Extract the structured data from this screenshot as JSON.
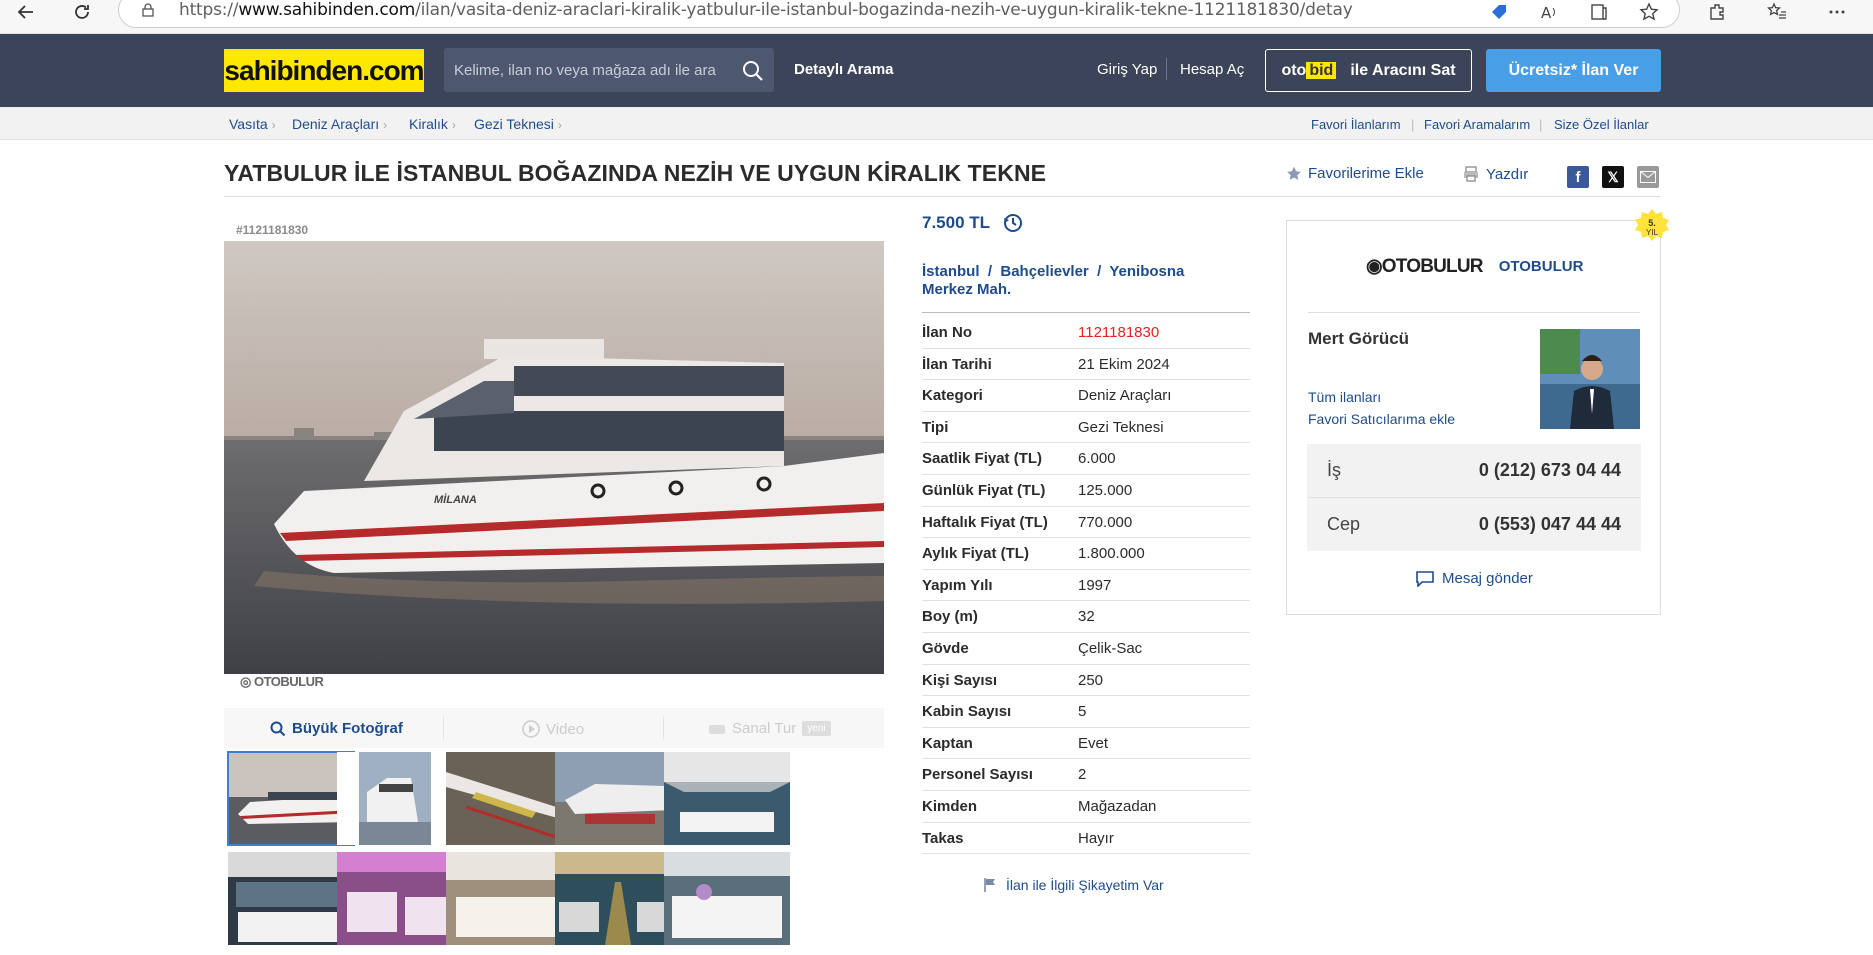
{
  "browser": {
    "url_prefix": "https://",
    "url_host": "www.sahibinden.com",
    "url_path": "/ilan/vasita-deniz-araclari-kiralik-yatbulur-ile-istanbul-bogazinda-nezih-ve-uygun-kiralik-tekne-1121181830/detay"
  },
  "header": {
    "logo": "sahibinden.com",
    "search_placeholder": "Kelime, ilan no veya mağaza adı ile ara",
    "advanced_search": "Detaylı Arama",
    "login": "Giriş Yap",
    "register": "Hesap Aç",
    "otobid_oto": "oto",
    "otobid_bid": "bid",
    "otobid_label": "ile Aracını Sat",
    "post_ad": "Ücretsiz* İlan Ver"
  },
  "breadcrumb": [
    "Vasıta",
    "Deniz Araçları",
    "Kiralık",
    "Gezi Teknesi"
  ],
  "top_links": [
    "Favori İlanlarım",
    "Favori Aramalarım",
    "Size Özel İlanlar"
  ],
  "listing": {
    "title": "YATBULUR İLE İSTANBUL BOĞAZINDA NEZİH VE UYGUN KİRALIK TEKNE",
    "add_favorite": "Favorilerime Ekle",
    "print": "Yazdır",
    "ad_id": "#1121181830",
    "watermark": "OTOBULUR",
    "boat_name": "MİLANA",
    "price": "7.500 TL",
    "location": [
      "İstanbul",
      "Bahçelievler",
      "Yenibosna Merkez Mah."
    ],
    "report": "İlan ile İlgili Şikayetim Var"
  },
  "gallery_tabs": {
    "big_photo": "Büyük Fotoğraf",
    "video": "Video",
    "virtual_tour": "Sanal Tur",
    "new_tag": "yeni"
  },
  "info": [
    {
      "k": "İlan No",
      "v": "1121181830"
    },
    {
      "k": "İlan Tarihi",
      "v": "21 Ekim 2024"
    },
    {
      "k": "Kategori",
      "v": "Deniz Araçları"
    },
    {
      "k": "Tipi",
      "v": "Gezi Teknesi"
    },
    {
      "k": "Saatlik Fiyat (TL)",
      "v": "6.000"
    },
    {
      "k": "Günlük Fiyat (TL)",
      "v": "125.000"
    },
    {
      "k": "Haftalık Fiyat (TL)",
      "v": "770.000"
    },
    {
      "k": "Aylık Fiyat (TL)",
      "v": "1.800.000"
    },
    {
      "k": "Yapım Yılı",
      "v": "1997"
    },
    {
      "k": "Boy (m)",
      "v": "32"
    },
    {
      "k": "Gövde",
      "v": "Çelik-Sac"
    },
    {
      "k": "Kişi Sayısı",
      "v": "250"
    },
    {
      "k": "Kabin Sayısı",
      "v": "5"
    },
    {
      "k": "Kaptan",
      "v": "Evet"
    },
    {
      "k": "Personel Sayısı",
      "v": "2"
    },
    {
      "k": "Kimden",
      "v": "Mağazadan"
    },
    {
      "k": "Takas",
      "v": "Hayır"
    }
  ],
  "seller": {
    "store_logo": "OTOBULUR",
    "store_name": "OTOBULUR",
    "badge_line1": "5.",
    "badge_line2": "YIL",
    "name": "Mert Görücü",
    "all_ads": "Tüm ilanları",
    "add_fav_seller": "Favori Satıcılarıma ekle",
    "phones": [
      {
        "label": "İş",
        "number": "0 (212) 673 04 44"
      },
      {
        "label": "Cep",
        "number": "0 (553) 047 44 44"
      }
    ],
    "message": "Mesaj gönder"
  }
}
